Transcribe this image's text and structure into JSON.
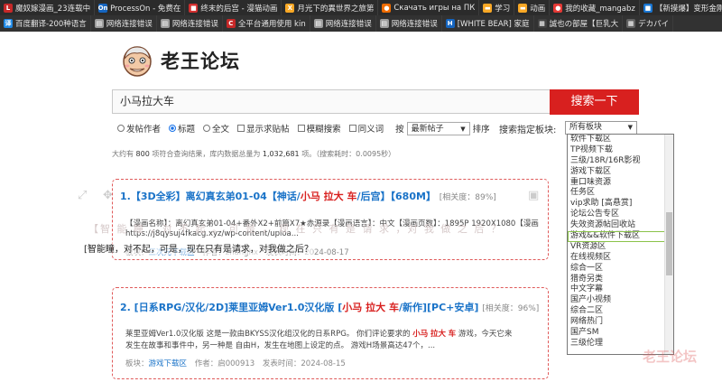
{
  "bookmarks_row1": [
    {
      "icon": "comic-icon",
      "label": "魔奴嫁漫画_23连载中",
      "color": "#c62828",
      "glyph": "L"
    },
    {
      "icon": "processon-icon",
      "label": "ProcessOn - 免费在",
      "color": "#1565c0",
      "glyph": "On"
    },
    {
      "icon": "page-icon",
      "label": "终末的后宫 - 漫猫动画",
      "color": "#d32f2f",
      "glyph": "■"
    },
    {
      "icon": "x-icon",
      "label": "月光下的異世界之旅第",
      "color": "#f9a825",
      "glyph": "X"
    },
    {
      "icon": "download-icon",
      "label": "Скачать игры на ПК",
      "color": "#ef6c00",
      "glyph": "●"
    },
    {
      "icon": "folder-icon",
      "label": "学习",
      "color": "#f9a825",
      "glyph": "▬"
    },
    {
      "icon": "folder-icon",
      "label": "动画",
      "color": "#f9a825",
      "glyph": "▬"
    },
    {
      "icon": "star-icon",
      "label": "我的收藏_mangabz",
      "color": "#e53935",
      "glyph": "●"
    },
    {
      "icon": "page-icon",
      "label": "【新摸爆】变形金刚",
      "color": "#1976d2",
      "glyph": "■"
    }
  ],
  "bookmarks_row2": [
    {
      "icon": "translate-icon",
      "label": "百度翻译-200种语言",
      "color": "#1e88e5",
      "glyph": "译"
    },
    {
      "icon": "error-page-icon",
      "label": "网络连接错误",
      "color": "#9e9e9e",
      "glyph": "▤"
    },
    {
      "icon": "error-page-icon",
      "label": "网络连接错误",
      "color": "#9e9e9e",
      "glyph": "▤"
    },
    {
      "icon": "plus-icon",
      "label": "全平台通用使用 kin",
      "color": "#c62828",
      "glyph": "C"
    },
    {
      "icon": "error-page-icon",
      "label": "网络连接错误",
      "color": "#9e9e9e",
      "glyph": "▤"
    },
    {
      "icon": "error-page-icon",
      "label": "网络连接错误",
      "color": "#9e9e9e",
      "glyph": "▤"
    },
    {
      "icon": "bear-icon",
      "label": "[WHITE BEAR] 家庭",
      "color": "#1565c0",
      "glyph": "H"
    },
    {
      "icon": "page-icon",
      "label": "誠也の部屋【巨乳大",
      "color": "#424242",
      "glyph": "▦"
    },
    {
      "icon": "page-icon",
      "label": "デカパイ",
      "color": "#616161",
      "glyph": "▦"
    }
  ],
  "site": {
    "name": "老王论坛",
    "logo_icon": "old-man-face-icon"
  },
  "search": {
    "query": "小马拉大车",
    "button": "搜索一下"
  },
  "options": {
    "radios": [
      "发帖作者",
      "标题",
      "全文"
    ],
    "selected_radio": "标题",
    "checkboxes": [
      "显示求贴帖",
      "模糊搜索",
      "同义词"
    ],
    "sort_prefix": "按",
    "sort_value": "最新帖子",
    "sort_suffix": "排序",
    "board_label": "搜索指定板块:",
    "board_value": "所有板块"
  },
  "stats": {
    "prefix": "大约有",
    "count": "800",
    "mid": "项符合查询结果，库内数据总量为",
    "total": "1,032,681",
    "suffix": "项。（搜索耗时：0.0095秒）"
  },
  "result1": {
    "title_pre": "1.【3D全彩】离幻真玄弟01-04【神话/",
    "hl1": "小马",
    "hl2": "拉大",
    "hl3": "车",
    "title_post": "/后宫】【680M】",
    "relevance": "[相关度：89%]",
    "body1": "【漫画名称】：离幻真玄弟01-04+番外X2+前篇X7★赤源录【漫画语言】：中文【漫画页数】：1895P 1920X1080【漫画",
    "body2": "https://j8qysuj4fkacg.xyz/wp-content/uploa...",
    "meta_board_label": "板块：",
    "meta_board": "三次元下载区",
    "meta_author": "作者：zhanghx",
    "meta_date": "发表时间：2024-08-17"
  },
  "overlay": {
    "subtitle": "[智能瞳，对不起，可是，现在只有是请求，对我做之后？",
    "faint": "【智 能 瞳 ，对 不 起 。 可 是 ， 现 在 只 有 是 请 求 ，对 我 做 之 后 ？"
  },
  "result2": {
    "title_pre": "2. [日系RPG/汉化/2D]莱里亚姆Ver1.0汉化版 [",
    "hl1": "小马",
    "hl2": "拉大",
    "hl3": "车",
    "title_post": "/新作][PC+安卓]",
    "relevance": "[相关度：96%]",
    "body1_pre": "莱里亚姆Ver1.0汉化版 这是一款由BKYSS汉化组汉化的日系RPG。 你们评论要求的",
    "body1_post": "游戏，今天它来",
    "body2": "发生在故事和事件中，另一种是 自由H，发生在地图上设定的点。 游戏H场景高达47个，...",
    "meta_board_label": "板块：",
    "meta_board": "游戏下载区",
    "meta_author": "作者：启000913",
    "meta_date": "发表时间：2024-08-15"
  },
  "dropdown": {
    "items": [
      "软件下载区",
      "TP视频下载",
      "三级/18R/16R影视",
      "游戏下载区",
      "重口味资源",
      "任务区",
      "vip求助 [高悬赏]",
      "论坛公告专区",
      "失效资源帖回收站",
      "游戏&&软件下载区",
      "VR资源区",
      "在线视频区",
      "综合一区",
      "猎奇另类",
      "中文字幕",
      "国产小视频",
      "综合二区",
      "网络热门",
      "国产SM",
      "三级伦理"
    ],
    "highlighted": "游戏&&软件下载区"
  },
  "watermark": "老王论坛"
}
